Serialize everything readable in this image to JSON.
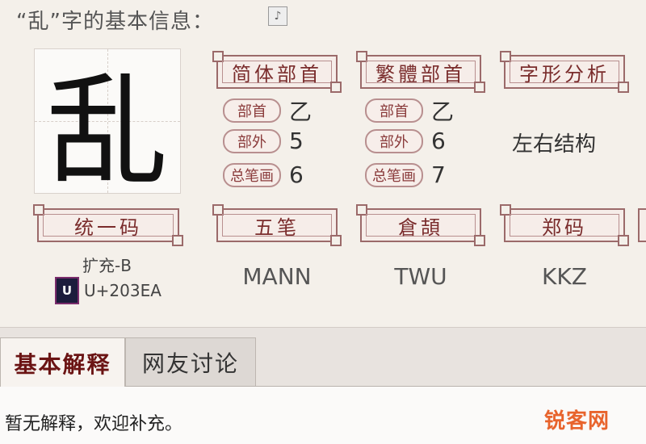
{
  "header": {
    "title": "“乱”字的基本信息：",
    "icon": "speaker-icon"
  },
  "character": {
    "glyph": "乱"
  },
  "sections": {
    "simplified_radical": "简体部首",
    "traditional_radical": "繁體部首",
    "glyph_analysis": "字形分析"
  },
  "tags": {
    "radical": "部首",
    "outside": "部外",
    "total_strokes": "总笔画"
  },
  "simplified": {
    "radical": "乙",
    "outside": "5",
    "strokes": "6"
  },
  "traditional": {
    "radical": "乙",
    "outside": "6",
    "strokes": "7"
  },
  "structure": "左右结构",
  "codes": {
    "labels": {
      "unicode": "统一码",
      "wubi": "五笔",
      "cangjie": "倉頡",
      "zhengma": "郑码"
    },
    "extension": "扩充-B",
    "unicode_logo": "U",
    "unicode": "U+203EA",
    "wubi": "MANN",
    "cangjie": "TWU",
    "zhengma": "KKZ"
  },
  "tabs": [
    {
      "label": "基本解释"
    },
    {
      "label": "网友讨论"
    }
  ],
  "content": {
    "text": "暂无解释，欢迎补充。"
  },
  "watermark": "锐客网"
}
